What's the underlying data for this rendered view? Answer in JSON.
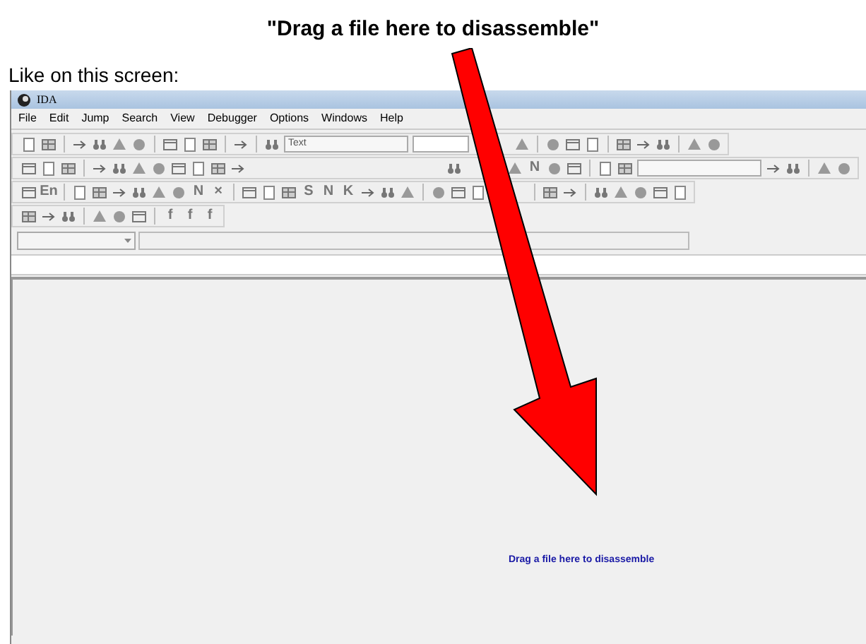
{
  "heading": "\"Drag a file here to disassemble\"",
  "caption": "Like on this screen:",
  "window": {
    "title": "IDA"
  },
  "menu": [
    "File",
    "Edit",
    "Jump",
    "Search",
    "View",
    "Debugger",
    "Options",
    "Windows",
    "Help"
  ],
  "toolbars": [
    [
      {
        "kind": "icon"
      },
      {
        "kind": "icon"
      },
      {
        "kind": "sep"
      },
      {
        "kind": "icon"
      },
      {
        "kind": "icon"
      },
      {
        "kind": "icon"
      },
      {
        "kind": "icon"
      },
      {
        "kind": "sep"
      },
      {
        "kind": "icon"
      },
      {
        "kind": "icon"
      },
      {
        "kind": "icon"
      },
      {
        "kind": "sep"
      },
      {
        "kind": "icon"
      },
      {
        "kind": "sep"
      },
      {
        "kind": "icon"
      },
      {
        "kind": "combo",
        "value": "Text"
      },
      {
        "kind": "field"
      },
      {
        "kind": "space"
      },
      {
        "kind": "icon"
      },
      {
        "kind": "sep"
      },
      {
        "kind": "icon"
      },
      {
        "kind": "icon"
      },
      {
        "kind": "icon"
      },
      {
        "kind": "sep"
      },
      {
        "kind": "icon"
      },
      {
        "kind": "icon"
      },
      {
        "kind": "icon"
      },
      {
        "kind": "sep"
      },
      {
        "kind": "icon"
      },
      {
        "kind": "icon"
      }
    ],
    [
      {
        "kind": "icon"
      },
      {
        "kind": "icon"
      },
      {
        "kind": "icon"
      },
      {
        "kind": "sep"
      },
      {
        "kind": "icon"
      },
      {
        "kind": "icon"
      },
      {
        "kind": "icon"
      },
      {
        "kind": "icon"
      },
      {
        "kind": "icon"
      },
      {
        "kind": "icon"
      },
      {
        "kind": "icon"
      },
      {
        "kind": "icon"
      },
      {
        "kind": "gap"
      },
      {
        "kind": "icon"
      },
      {
        "kind": "space"
      },
      {
        "kind": "icon"
      },
      {
        "kind": "glyph",
        "text": "N"
      },
      {
        "kind": "icon"
      },
      {
        "kind": "icon"
      },
      {
        "kind": "sep"
      },
      {
        "kind": "icon"
      },
      {
        "kind": "icon"
      },
      {
        "kind": "combo"
      },
      {
        "kind": "icon"
      },
      {
        "kind": "icon"
      },
      {
        "kind": "sep"
      },
      {
        "kind": "icon"
      },
      {
        "kind": "icon"
      }
    ],
    [
      {
        "kind": "icon"
      },
      {
        "kind": "glyph",
        "text": "En"
      },
      {
        "kind": "sep"
      },
      {
        "kind": "icon"
      },
      {
        "kind": "icon"
      },
      {
        "kind": "icon"
      },
      {
        "kind": "icon"
      },
      {
        "kind": "icon"
      },
      {
        "kind": "icon"
      },
      {
        "kind": "glyph",
        "text": "N"
      },
      {
        "kind": "glyph",
        "text": "×"
      },
      {
        "kind": "sep"
      },
      {
        "kind": "icon"
      },
      {
        "kind": "icon"
      },
      {
        "kind": "icon"
      },
      {
        "kind": "glyph",
        "text": "S"
      },
      {
        "kind": "glyph",
        "text": "N"
      },
      {
        "kind": "glyph",
        "text": "K"
      },
      {
        "kind": "icon"
      },
      {
        "kind": "icon"
      },
      {
        "kind": "icon"
      },
      {
        "kind": "sep"
      },
      {
        "kind": "icon"
      },
      {
        "kind": "icon"
      },
      {
        "kind": "icon"
      },
      {
        "kind": "space"
      },
      {
        "kind": "sep"
      },
      {
        "kind": "icon"
      },
      {
        "kind": "icon"
      },
      {
        "kind": "sep"
      },
      {
        "kind": "icon"
      },
      {
        "kind": "icon"
      },
      {
        "kind": "icon"
      },
      {
        "kind": "icon"
      },
      {
        "kind": "icon"
      }
    ],
    [
      {
        "kind": "icon"
      },
      {
        "kind": "icon"
      },
      {
        "kind": "icon"
      },
      {
        "kind": "sep"
      },
      {
        "kind": "icon"
      },
      {
        "kind": "icon"
      },
      {
        "kind": "icon"
      },
      {
        "kind": "sep"
      },
      {
        "kind": "glyph",
        "text": "f"
      },
      {
        "kind": "glyph",
        "text": "f"
      },
      {
        "kind": "glyph",
        "text": "f"
      }
    ]
  ],
  "drop_hint": "Drag a file here to disassemble"
}
